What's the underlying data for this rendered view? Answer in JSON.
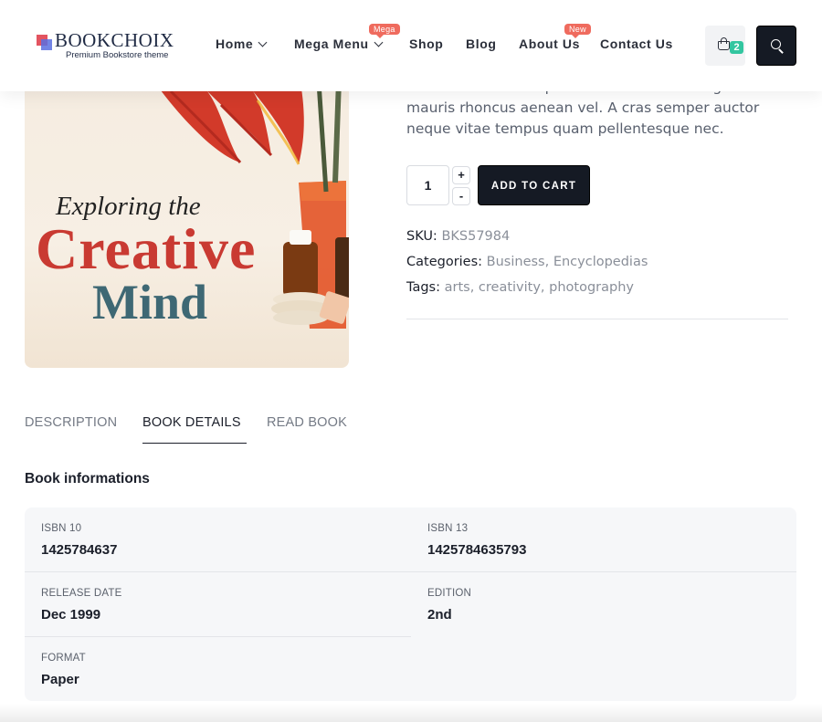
{
  "header": {
    "logo": {
      "name": "BOOKCHOIX",
      "tagline": "Premium Bookstore theme"
    },
    "nav": [
      {
        "label": "Home",
        "has_dropdown": true,
        "badge": ""
      },
      {
        "label": "Mega Menu",
        "has_dropdown": true,
        "badge": "Mega"
      },
      {
        "label": "Shop",
        "has_dropdown": false,
        "badge": ""
      },
      {
        "label": "Blog",
        "has_dropdown": false,
        "badge": ""
      },
      {
        "label": "About Us",
        "has_dropdown": false,
        "badge": "New"
      },
      {
        "label": "Contact Us",
        "has_dropdown": false,
        "badge": ""
      }
    ],
    "cart_count": "2",
    "icons": {
      "cart": "shopping-bag-icon",
      "search": "search-icon"
    },
    "colors": {
      "badge": "#ef6b5e",
      "cart_count": "#33c6a0",
      "dark_button": "#151a24"
    }
  },
  "product": {
    "cover": {
      "line1": "Exploring the",
      "line2": "Creative",
      "line3": "Mind"
    },
    "description": "faucibus ornare suspendisse sed. Vitae congue mauris rhoncus aenean vel. A cras semper auctor neque vitae tempus quam pellentesque nec.",
    "quantity": "1",
    "qty_plus": "+",
    "qty_minus": "-",
    "add_to_cart": "ADD TO CART",
    "sku_label": "SKU:",
    "sku": "BKS57984",
    "categories_label": "Categories:",
    "categories": "Business, Encyclopedias",
    "tags_label": "Tags:",
    "tags": "arts, creativity, photography"
  },
  "tabs": [
    {
      "label": "DESCRIPTION",
      "active": false
    },
    {
      "label": "BOOK DETAILS",
      "active": true
    },
    {
      "label": "READ BOOK",
      "active": false
    }
  ],
  "book_info": {
    "title": "Book informations",
    "fields": [
      {
        "label": "ISBN 10",
        "value": "1425784637"
      },
      {
        "label": "ISBN 13",
        "value": "1425784635793"
      },
      {
        "label": "RELEASE DATE",
        "value": "Dec 1999"
      },
      {
        "label": "EDITION",
        "value": "2nd"
      },
      {
        "label": "FORMAT",
        "value": "Paper"
      }
    ]
  }
}
